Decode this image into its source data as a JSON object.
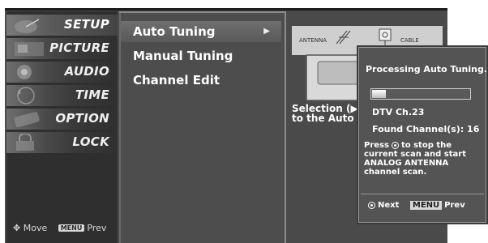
{
  "categories": [
    {
      "label": "SETUP",
      "icon": "satellite-dish-icon"
    },
    {
      "label": "PICTURE",
      "icon": "picture-icon"
    },
    {
      "label": "AUDIO",
      "icon": "speaker-icon"
    },
    {
      "label": "TIME",
      "icon": "clock-icon"
    },
    {
      "label": "OPTION",
      "icon": "option-tag-icon"
    },
    {
      "label": "LOCK",
      "icon": "lock-icon"
    }
  ],
  "category_footer": {
    "move_label": "Move",
    "menu_key": "MENU",
    "prev_label": "Prev"
  },
  "submenu": [
    {
      "label": "Auto Tuning",
      "arrow": "▶"
    },
    {
      "label": "Manual Tuning"
    },
    {
      "label": "Channel Edit"
    }
  ],
  "diagram": {
    "antenna_label": "ANTENNA",
    "cable_label": "CABLE"
  },
  "selection_text": {
    "line1": "Selection (▶ o",
    "line2": "to the Auto T"
  },
  "popup": {
    "title": "Processing Auto Tuning. .",
    "progress": 0.14,
    "channel": "DTV Ch.23",
    "found": "Found Channel(s): 16",
    "instruction_press": "Press",
    "instruction_rest": "to stop the current scan and start ANALOG ANTENNA channel scan.",
    "next_label": "Next",
    "menu_key": "MENU",
    "prev_label": "Prev"
  },
  "colors": {
    "menu_bg": "#4b4b4b",
    "popup_bg": "#545454",
    "text": "#ffffff"
  }
}
